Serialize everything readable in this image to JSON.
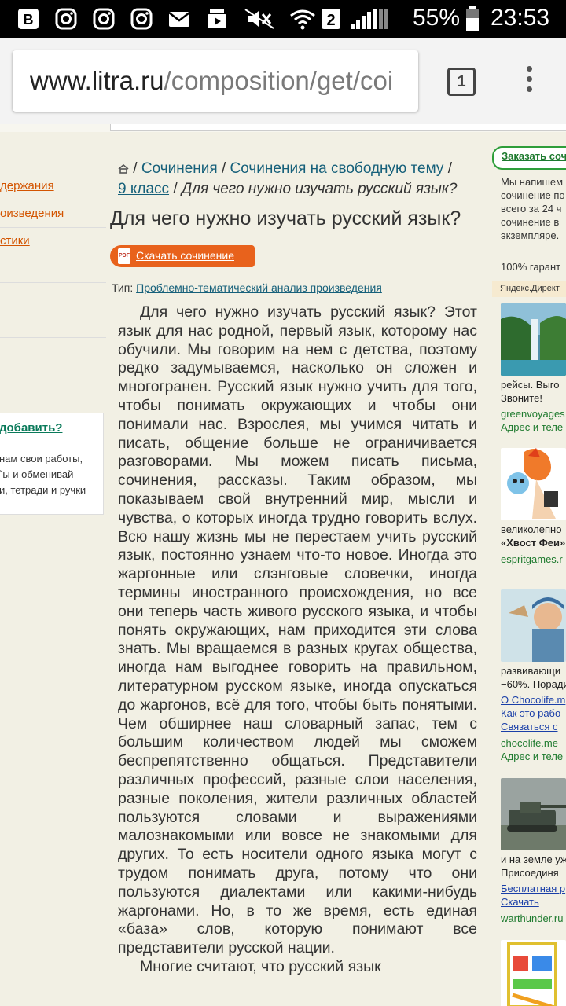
{
  "status_bar": {
    "battery": "55%",
    "time": "23:53",
    "sim": "2"
  },
  "browser": {
    "url_host": "www.litra.ru",
    "url_path": "/composition/get/coi",
    "tab_count": "1"
  },
  "left_sidebar": {
    "links": [
      "держания",
      "оизведения",
      "стики"
    ],
    "add_link": "добавить?",
    "add_lines": [
      "нам свои работы,",
      "`ы и обменивай",
      "и, тетради и ручки"
    ]
  },
  "breadcrumb": {
    "items": [
      "Сочинения",
      "Сочинения на свободную тему",
      "9 класс"
    ],
    "current": "Для чего нужно изучать русский язык?"
  },
  "article": {
    "title": "Для чего нужно изучать русский язык?",
    "download_label": "Скачать сочинение",
    "pdf_badge": "PDF",
    "type_label": "Тип:",
    "type_value": "Проблемно-тематический анализ произведения",
    "paragraph_1": "Для чего нужно изучать русский язык? Этот язык для нас родной, первый язык, которому нас обучили. Мы говорим на нем с детства, поэтому редко задумываемся, насколько он сложен и многогранен. Русский язык нужно учить для того, чтобы понимать окружающих и чтобы они понимали нас. Взрослея, мы учимся читать и писать, общение больше не ограничивается разговорами. Мы можем писать письма, сочинения, рассказы. Таким образом, мы показываем свой внутренний мир, мысли и чувства, о которых иногда трудно говорить вслух. Всю нашу жизнь мы не перестаем учить русский язык, постоянно узнаем что-то новое. Иногда это жаргонные или слэнговые словечки, иногда термины иностранного происхождения, но все они теперь часть живого русского языка, и чтобы понять окружающих, нам приходится эти слова знать. Мы вращаемся в разных кругах общества, иногда нам выгоднее говорить на правильном, литературном русском языке, иногда опускаться до жаргонов, всё для того, чтобы быть понятыми. Чем обширнее наш словарный запас, тем с большим количеством людей мы сможем беспрепятственно общаться. Представители различных профессий, разные слои населения, разные поколения, жители различных областей пользуются словами и выражениями малознакомыми или вовсе не знакомыми для других. То есть носители одного языка могут с трудом понимать друга, потому что они пользуются диалектами или какими-нибудь жаргонами. Но, в то же время, есть единая «база» слов, которую понимают все представители русской нации.",
    "paragraph_2": "Многие считают, что русский язык"
  },
  "right_sidebar": {
    "order_label": "Заказать сочи",
    "promo_lines": [
      "Мы напишем",
      "сочинение по",
      "всего за 24 ч",
      "сочинение в",
      "экземпляре."
    ],
    "guarantee": "100% гарант",
    "yandex_label": "Яндекс.Директ",
    "ads": [
      {
        "lines": [
          "рейсы. Выго",
          "Звоните!"
        ],
        "domain": "greenvoyages",
        "extra": "Адрес и теле"
      },
      {
        "lines": [
          "великолепно",
          "«Хвост Феи»"
        ],
        "domain": "espritgames.r"
      },
      {
        "lines": [
          "развивающи",
          "−60%. Поради"
        ],
        "links": [
          "О Chocolife.m",
          "Как это рабо",
          "Связаться с"
        ],
        "domain": "chocolife.me",
        "extra": "Адрес и теле"
      },
      {
        "lines": [
          "и на земле уж",
          "Присоединя"
        ],
        "links": [
          "Бесплатная р",
          "Скачать"
        ],
        "domain": "warthunder.ru"
      }
    ]
  }
}
